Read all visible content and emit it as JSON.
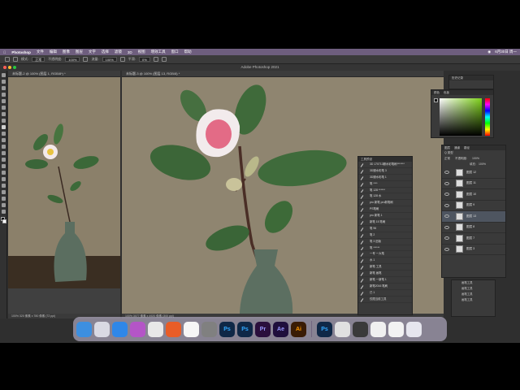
{
  "menubar": {
    "app_name": "Photoshop",
    "items": [
      "文件",
      "编辑",
      "图像",
      "图层",
      "文字",
      "选择",
      "滤镜",
      "3D",
      "视图",
      "增效工具",
      "窗口",
      "帮助"
    ],
    "clock": "6月30日 周一"
  },
  "options_bar": {
    "mode_label": "模式:",
    "mode_value": "正常",
    "opacity_label": "不透明度:",
    "opacity_value": "100%",
    "flow_label": "流量:",
    "flow_value": "100%",
    "smooth_label": "平滑:",
    "smooth_value": "0%"
  },
  "titlebar": {
    "title": "Adobe Photoshop 2021"
  },
  "doc_left": {
    "tab": "未标题-2 @ 100% (图层 1, RGB/8*) *",
    "status": "100%   320 像素 x 780 像素 (72 ppi)"
  },
  "doc_main": {
    "tab": "未标题-3 @ 100% (图层 13, RGB/8) *",
    "status": "100%   3077 像素 x 4920 像素 (300 ppi)"
  },
  "color_panel": {
    "tabs": [
      "颜色",
      "色板"
    ]
  },
  "actions_panel": {
    "title": "工具预设",
    "items": [
      "3D 170713服水彩笔刷*******",
      "3D服水彩笔 3",
      "3D服水彩笔 1",
      "笔 ****",
      "笔 128 ******",
      "笔 128 水",
      "pro 新笔 pro新笔刷",
      "PS笔刷",
      "pro 新笔 1",
      "新笔 15 笔刷",
      "笔 96",
      "笔 2",
      "笔 3 旧版",
      "笔 ******",
      "一号 一大笔",
      "水 1",
      "新笔 工具",
      "新笔 画笔",
      "新笔 一新笔 1",
      "新笔2016 笔刷",
      "已 1",
      "仅限当前工具"
    ]
  },
  "layers_panel": {
    "tabs": [
      "图层",
      "通道",
      "路径"
    ],
    "kind_label": "Q 类型",
    "blend_mode": "正常",
    "opacity_label": "不透明度:",
    "opacity_value": "100%",
    "fill_label": "填充:",
    "fill_value": "100%",
    "layers": [
      "图层 12",
      "图层 11",
      "图层 10",
      "图层 9",
      "图层 13",
      "图层 8",
      "图层 7",
      "图层 3"
    ]
  },
  "history_panel": {
    "title": "历史记录",
    "items": [
      "画笔工具",
      "画笔工具",
      "画笔工具",
      "画笔工具"
    ]
  },
  "dock": {
    "apps": [
      {
        "name": "Finder",
        "label": "",
        "color": "#3d8fe0"
      },
      {
        "name": "Launchpad",
        "label": "",
        "color": "#d9d9e3"
      },
      {
        "name": "Safari",
        "label": "",
        "color": "#2f87e8"
      },
      {
        "name": "Mail",
        "label": "",
        "color": "#b455c7"
      },
      {
        "name": "Chrome",
        "label": "",
        "color": "#e8e8e8"
      },
      {
        "name": "Brave",
        "label": "",
        "color": "#e85d27"
      },
      {
        "name": "Notes",
        "label": "",
        "color": "#f6f6f6"
      },
      {
        "name": "Preferences",
        "label": "",
        "color": "#808080"
      },
      {
        "name": "Photoshop",
        "label": "Ps",
        "color": "#0f2847"
      },
      {
        "name": "Photoshop 2",
        "label": "Ps",
        "color": "#0f2847"
      },
      {
        "name": "Premiere",
        "label": "Pr",
        "color": "#2a0f3c"
      },
      {
        "name": "After Effects",
        "label": "Ae",
        "color": "#1f0f3c"
      },
      {
        "name": "Illustrator",
        "label": "Ai",
        "color": "#3a1c05"
      }
    ],
    "recent": [
      {
        "name": "Photoshop running",
        "label": "Ps",
        "color": "#0f2847"
      },
      {
        "name": "Sketch",
        "label": "",
        "color": "#e0e0e0"
      },
      {
        "name": "Screenshot",
        "label": "",
        "color": "#3a3a3a"
      },
      {
        "name": "Preview",
        "label": "",
        "color": "#f0f0f0"
      },
      {
        "name": "Downloads",
        "label": "",
        "color": "#f2f2f2"
      },
      {
        "name": "Trash",
        "label": "",
        "color": "#e6e6ee"
      }
    ]
  },
  "colors": {
    "canvas_bg": "#8f8570",
    "leaf": "#3f6b3a",
    "vase": "#5c6f61",
    "petal_pink": "#e36b86"
  }
}
